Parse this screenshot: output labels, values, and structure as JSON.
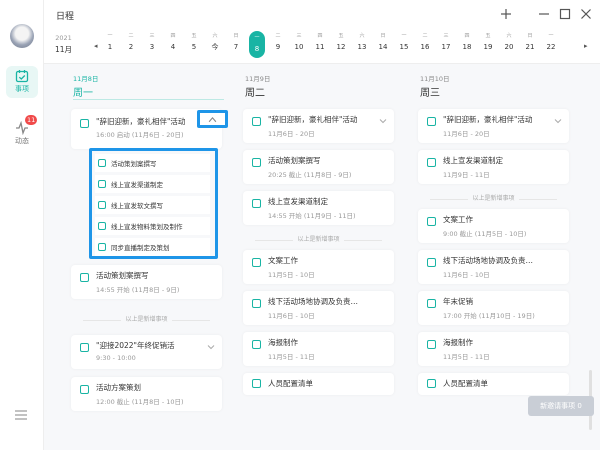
{
  "window": {
    "title": "日程",
    "controls": [
      "plus-icon",
      "minimize-icon",
      "maximize-icon",
      "close-icon"
    ]
  },
  "sidebar": {
    "items": [
      {
        "label": "事项",
        "icon": "calendar-check-icon",
        "active": true
      },
      {
        "label": "动态",
        "icon": "activity-icon",
        "badge": "11"
      }
    ]
  },
  "datebar": {
    "year": "2021",
    "month": "11月",
    "prev_arrow": "◂",
    "next_arrow": "▸",
    "days": [
      {
        "wd": "一",
        "dn": "1"
      },
      {
        "wd": "二",
        "dn": "2"
      },
      {
        "wd": "三",
        "dn": "3"
      },
      {
        "wd": "四",
        "dn": "4"
      },
      {
        "wd": "五",
        "dn": "5"
      },
      {
        "wd": "六",
        "dn": "今"
      },
      {
        "wd": "日",
        "dn": "7"
      },
      {
        "wd": "一",
        "dn": "8",
        "selected": true
      },
      {
        "wd": "二",
        "dn": "9"
      },
      {
        "wd": "三",
        "dn": "10"
      },
      {
        "wd": "四",
        "dn": "11"
      },
      {
        "wd": "五",
        "dn": "12"
      },
      {
        "wd": "六",
        "dn": "13"
      },
      {
        "wd": "日",
        "dn": "14"
      },
      {
        "wd": "一",
        "dn": "15"
      },
      {
        "wd": "二",
        "dn": "16"
      },
      {
        "wd": "三",
        "dn": "17"
      },
      {
        "wd": "四",
        "dn": "18"
      },
      {
        "wd": "五",
        "dn": "19"
      },
      {
        "wd": "六",
        "dn": "20"
      },
      {
        "wd": "日",
        "dn": "21"
      },
      {
        "wd": "一",
        "dn": "22"
      }
    ]
  },
  "columns": [
    {
      "date": "11月8日",
      "weekday": "周一",
      "today": true,
      "expanded_task": {
        "title": "\"辞旧迎新，豪礼相伴\"活动",
        "sub": "16:00 启动 (11月6日 - 20日)",
        "subtasks": [
          "活动策划案撰写",
          "线上宣发渠道制定",
          "线上宣发软文撰写",
          "线上宣发物料策划及制作",
          "同步直播制定及策划"
        ]
      },
      "cards_before": [
        {
          "title": "活动策划案撰写",
          "sub": "14:55 开始 (11月8日 - 9日)"
        }
      ],
      "separator": "以上是新增事项",
      "cards_after": [
        {
          "title": "\"迎接2022\"年终促销活",
          "sub": "9:30 - 10:00",
          "chevron": true
        },
        {
          "title": "活动方案策划",
          "sub": "12:00 截止 (11月8日 - 10日)"
        }
      ]
    },
    {
      "date": "11月9日",
      "weekday": "周二",
      "cards_before": [
        {
          "title": "\"辞旧迎新，豪礼相伴\"活动",
          "sub": "11月6日 - 20日",
          "chevron": true
        },
        {
          "title": "活动策划案撰写",
          "sub": "20:25 截止 (11月8日 - 9日)"
        },
        {
          "title": "线上宣发渠道制定",
          "sub": "14:55 开始 (11月9日 - 11日)"
        }
      ],
      "separator": "以上是新增事项",
      "cards_after": [
        {
          "title": "文案工作",
          "sub": "11月5日 - 10日"
        },
        {
          "title": "线下活动场地协调及负责…",
          "sub": "11月6日 - 10日"
        },
        {
          "title": "海报制作",
          "sub": "11月5日 - 11日"
        },
        {
          "title": "人员配置清单",
          "sub": ""
        }
      ]
    },
    {
      "date": "11月10日",
      "weekday": "周三",
      "cards_before": [
        {
          "title": "\"辞旧迎新，豪礼相伴\"活动",
          "sub": "11月6日 - 20日",
          "chevron": true
        },
        {
          "title": "线上宣发渠道制定",
          "sub": "11月9日 - 11日"
        }
      ],
      "separator": "以上是新增事项",
      "cards_after": [
        {
          "title": "文案工作",
          "sub": "9:00 截止 (11月5日 - 10日)"
        },
        {
          "title": "线下活动场地协调及负责…",
          "sub": "11月6日 - 10日"
        },
        {
          "title": "年末促销",
          "sub": "17:00 开始 (11月10日 - 19日)"
        },
        {
          "title": "海报制作",
          "sub": "11月5日 - 11日"
        },
        {
          "title": "人员配置清单",
          "sub": ""
        }
      ]
    }
  ],
  "footer": {
    "new_invites": "新邀请事项 0"
  },
  "colors": {
    "accent": "#19b4a4",
    "highlight": "#1e95e8",
    "badge": "#f04a4a"
  }
}
